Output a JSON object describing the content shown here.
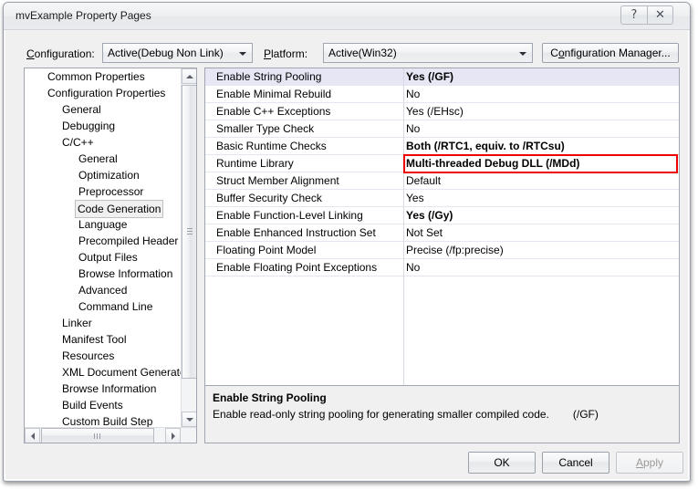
{
  "window": {
    "title": "mvExample Property Pages",
    "help_glyph": "?",
    "close_glyph": "✕"
  },
  "toolbar": {
    "configuration_label": "Configuration:",
    "configuration_value": "Active(Debug Non Link)",
    "platform_label": "Platform:",
    "platform_value": "Active(Win32)",
    "configuration_manager_label": "Configuration Manager..."
  },
  "tree": {
    "items": [
      {
        "label": "Common Properties",
        "level": 1,
        "selected": false
      },
      {
        "label": "Configuration Properties",
        "level": 1,
        "selected": false
      },
      {
        "label": "General",
        "level": 2,
        "selected": false
      },
      {
        "label": "Debugging",
        "level": 2,
        "selected": false
      },
      {
        "label": "C/C++",
        "level": 2,
        "selected": false
      },
      {
        "label": "General",
        "level": 3,
        "selected": false
      },
      {
        "label": "Optimization",
        "level": 3,
        "selected": false
      },
      {
        "label": "Preprocessor",
        "level": 3,
        "selected": false
      },
      {
        "label": "Code Generation",
        "level": 3,
        "selected": true
      },
      {
        "label": "Language",
        "level": 3,
        "selected": false
      },
      {
        "label": "Precompiled Header",
        "level": 3,
        "selected": false
      },
      {
        "label": "Output Files",
        "level": 3,
        "selected": false
      },
      {
        "label": "Browse Information",
        "level": 3,
        "selected": false
      },
      {
        "label": "Advanced",
        "level": 3,
        "selected": false
      },
      {
        "label": "Command Line",
        "level": 3,
        "selected": false
      },
      {
        "label": "Linker",
        "level": 2,
        "selected": false
      },
      {
        "label": "Manifest Tool",
        "level": 2,
        "selected": false
      },
      {
        "label": "Resources",
        "level": 2,
        "selected": false
      },
      {
        "label": "XML Document Generator",
        "level": 2,
        "selected": false
      },
      {
        "label": "Browse Information",
        "level": 2,
        "selected": false
      },
      {
        "label": "Build Events",
        "level": 2,
        "selected": false
      },
      {
        "label": "Custom Build Step",
        "level": 2,
        "selected": false
      }
    ]
  },
  "grid": {
    "rows": [
      {
        "name": "Enable String Pooling",
        "value": "Yes (/GF)",
        "bold": true,
        "selected": true,
        "highlighted": false
      },
      {
        "name": "Enable Minimal Rebuild",
        "value": "No",
        "bold": false,
        "selected": false,
        "highlighted": false
      },
      {
        "name": "Enable C++ Exceptions",
        "value": "Yes (/EHsc)",
        "bold": false,
        "selected": false,
        "highlighted": false
      },
      {
        "name": "Smaller Type Check",
        "value": "No",
        "bold": false,
        "selected": false,
        "highlighted": false
      },
      {
        "name": "Basic Runtime Checks",
        "value": "Both (/RTC1, equiv. to /RTCsu)",
        "bold": true,
        "selected": false,
        "highlighted": false
      },
      {
        "name": "Runtime Library",
        "value": "Multi-threaded Debug DLL (/MDd)",
        "bold": true,
        "selected": false,
        "highlighted": true
      },
      {
        "name": "Struct Member Alignment",
        "value": "Default",
        "bold": false,
        "selected": false,
        "highlighted": false
      },
      {
        "name": "Buffer Security Check",
        "value": "Yes",
        "bold": false,
        "selected": false,
        "highlighted": false
      },
      {
        "name": "Enable Function-Level Linking",
        "value": "Yes (/Gy)",
        "bold": true,
        "selected": false,
        "highlighted": false
      },
      {
        "name": "Enable Enhanced Instruction Set",
        "value": "Not Set",
        "bold": false,
        "selected": false,
        "highlighted": false
      },
      {
        "name": "Floating Point Model",
        "value": "Precise (/fp:precise)",
        "bold": false,
        "selected": false,
        "highlighted": false
      },
      {
        "name": "Enable Floating Point Exceptions",
        "value": "No",
        "bold": false,
        "selected": false,
        "highlighted": false
      }
    ],
    "highlight_color": "#ee0000"
  },
  "description": {
    "title": "Enable String Pooling",
    "body": "Enable read-only string pooling for generating smaller compiled code.",
    "switch": "(/GF)"
  },
  "buttons": {
    "ok_label": "OK",
    "cancel_label": "Cancel",
    "apply_label": "Apply"
  }
}
